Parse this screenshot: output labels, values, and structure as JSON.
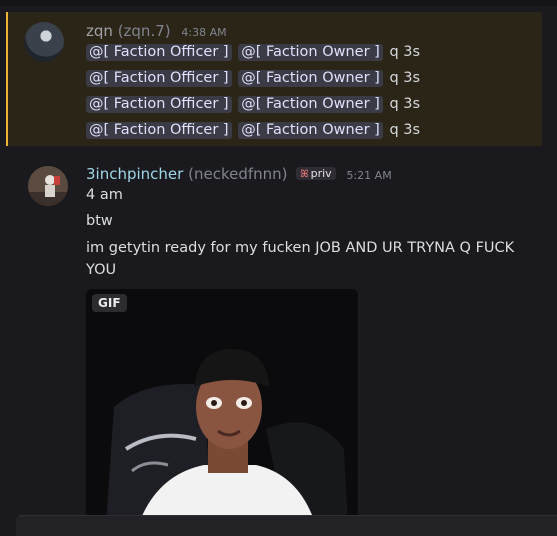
{
  "message1": {
    "username": "zqn",
    "tag": "(zqn.7)",
    "time": "4:38 AM",
    "lines": [
      {
        "mention_a": "@[ Faction Officer ]",
        "mention_b": "@[ Faction Owner ]",
        "text": "q 3s"
      },
      {
        "mention_a": "@[ Faction Officer ]",
        "mention_b": "@[ Faction Owner ]",
        "text": "q 3s"
      },
      {
        "mention_a": "@[ Faction Officer ]",
        "mention_b": "@[ Faction Owner ]",
        "text": "q 3s"
      },
      {
        "mention_a": "@[ Faction Officer ]",
        "mention_b": "@[ Faction Owner ]",
        "text": "q 3s"
      }
    ]
  },
  "message2": {
    "username": "3inchpincher",
    "tag": "(neckedfnnn)",
    "badge": "priv",
    "time": "5:21 AM",
    "lines": [
      "4 am",
      "btw",
      "im getytin ready for my fucken JOB AND UR TRYNA Q FUCK YOU"
    ],
    "gif_label": "GIF"
  },
  "colors": {
    "mention_highlight_bg": "#2a2517",
    "mention_highlight_bar": "#f0b232",
    "username2": "#9fd6e8"
  }
}
